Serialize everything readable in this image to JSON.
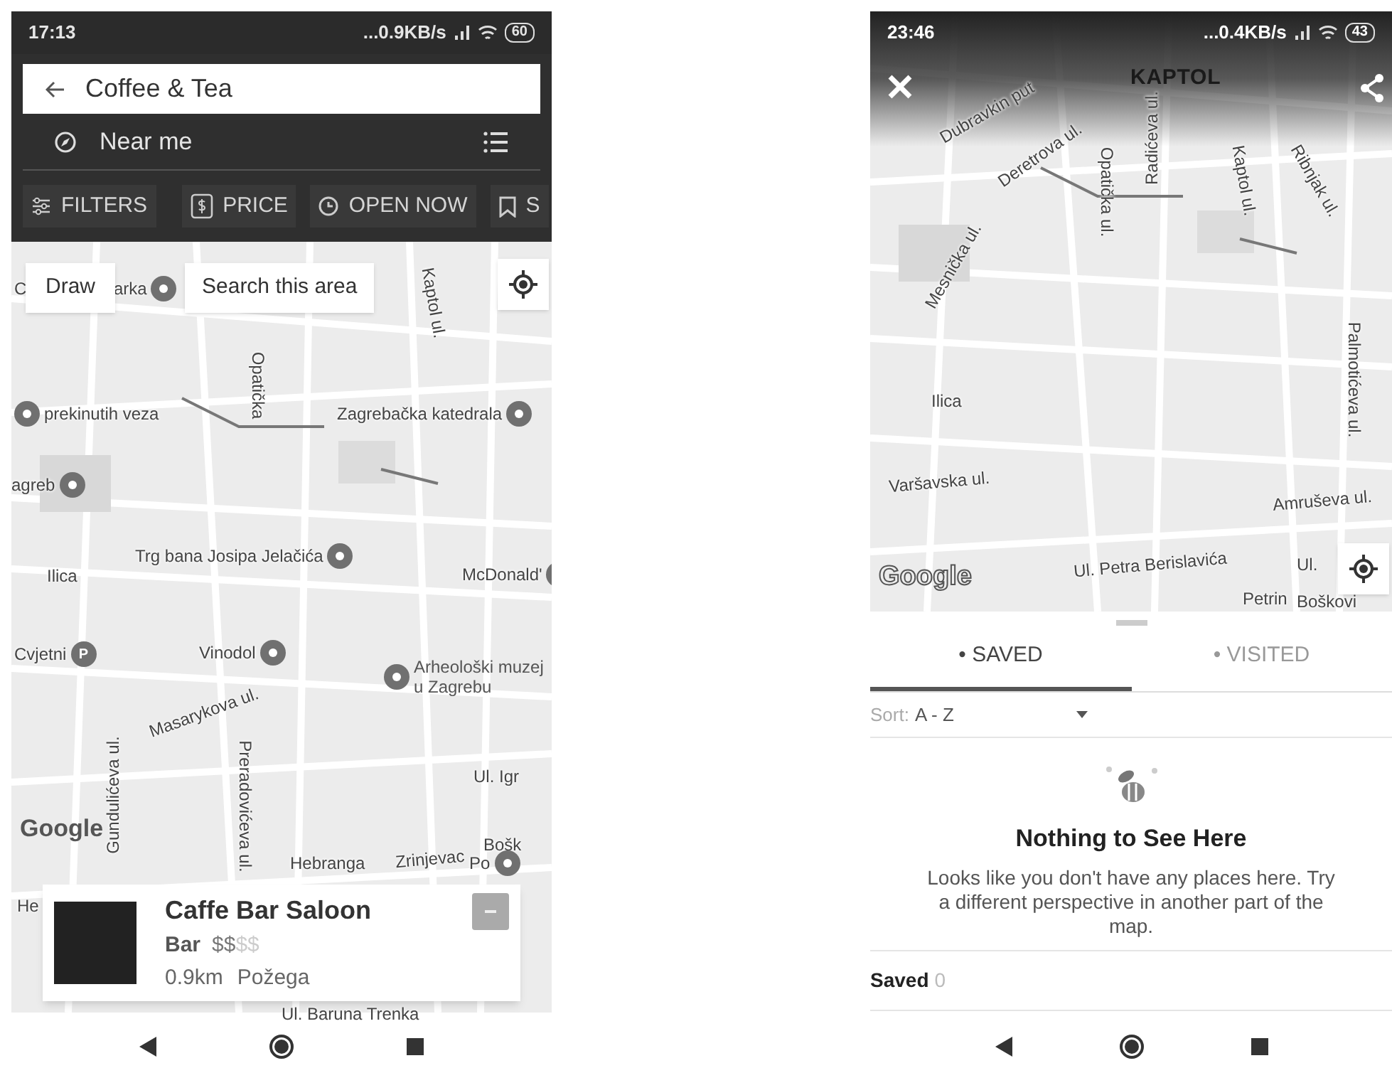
{
  "phones": [
    {
      "kind": "search",
      "status_bar": {
        "time": "17:13",
        "speed": "...0.9KB/s",
        "battery": "60"
      },
      "search": {
        "value": "Coffee & Tea"
      },
      "location": "Near me",
      "chips": [
        {
          "label": "FILTERS"
        },
        {
          "label": "PRICE"
        },
        {
          "label": "OPEN NOW"
        },
        {
          "label": "S"
        }
      ],
      "map": {
        "buttons": [
          "Draw",
          "Search this area"
        ],
        "logo": "Google",
        "labels": [
          {
            "text": "C",
            "kind": "street"
          },
          {
            "text": "arka",
            "kind": "poi"
          },
          {
            "text": "Opatička",
            "kind": "street"
          },
          {
            "text": "Kaptol ul.",
            "kind": "street"
          },
          {
            "text": "prekinutih veza",
            "kind": "poi"
          },
          {
            "text": "Zagrebačka katedrala",
            "kind": "poi"
          },
          {
            "text": "agreb",
            "kind": "poi"
          },
          {
            "text": "Trg bana Josipa Jelačića",
            "kind": "poi"
          },
          {
            "text": "Ilica",
            "kind": "street"
          },
          {
            "text": "McDonald'",
            "kind": "poi"
          },
          {
            "text": "Cvjetni",
            "kind": "poi",
            "pin_text": "P"
          },
          {
            "text": "Vinodol",
            "kind": "poi"
          },
          {
            "text": "Arheološki muzej u Zagrebu",
            "kind": "poi"
          },
          {
            "text": "Masarykova ul.",
            "kind": "street"
          },
          {
            "text": "Preradovićeva ul.",
            "kind": "street"
          },
          {
            "text": "Gundulićeva ul.",
            "kind": "street"
          },
          {
            "text": "Ul. Igr",
            "kind": "street"
          },
          {
            "text": "Bošk",
            "kind": "street"
          },
          {
            "text": "Hebranga",
            "kind": "street"
          },
          {
            "text": "Zrinjevac",
            "kind": "street"
          },
          {
            "text": "Po",
            "kind": "poi"
          },
          {
            "text": "He",
            "kind": "street"
          },
          {
            "text": "Ul. Baruna Trenka",
            "kind": "street"
          }
        ]
      },
      "card": {
        "name": "Caffe Bar Saloon",
        "category": "Bar",
        "price_active": "$$",
        "price_inactive": "$$",
        "distance": "0.9km",
        "locality": "Požega"
      }
    },
    {
      "kind": "saved",
      "status_bar": {
        "time": "23:46",
        "speed": "...0.4KB/s",
        "battery": "43"
      },
      "map": {
        "logo": "Google",
        "labels": [
          {
            "text": "KAPTOL",
            "kind": "district"
          },
          {
            "text": "Dubravkin put",
            "kind": "street"
          },
          {
            "text": "Deretrova ul.",
            "kind": "street"
          },
          {
            "text": "Opatička ul.",
            "kind": "street"
          },
          {
            "text": "Radićeva ul.",
            "kind": "street"
          },
          {
            "text": "Kaptol ul.",
            "kind": "street"
          },
          {
            "text": "Ribnjak ul.",
            "kind": "street"
          },
          {
            "text": "Mesnička ul.",
            "kind": "street"
          },
          {
            "text": "Ilica",
            "kind": "street"
          },
          {
            "text": "Varšavska ul.",
            "kind": "street"
          },
          {
            "text": "Amruševa ul.",
            "kind": "street"
          },
          {
            "text": "Palmotićeva ul.",
            "kind": "street"
          },
          {
            "text": "Ul. Petra Berislavića",
            "kind": "street"
          },
          {
            "text": "Petrin",
            "kind": "street"
          },
          {
            "text": "Boškovi",
            "kind": "street"
          },
          {
            "text": "Ul.",
            "kind": "street"
          }
        ]
      },
      "tabs": [
        {
          "label": "• SAVED",
          "selected": true
        },
        {
          "label": "• VISITED",
          "selected": false
        }
      ],
      "sort": {
        "label": "Sort:",
        "value": "A - Z"
      },
      "empty": {
        "title": "Nothing to See Here",
        "message": "Looks like you don't have any places here. Try a different perspective in another part of the map."
      },
      "footer": {
        "label": "Saved",
        "count": "0"
      }
    }
  ]
}
